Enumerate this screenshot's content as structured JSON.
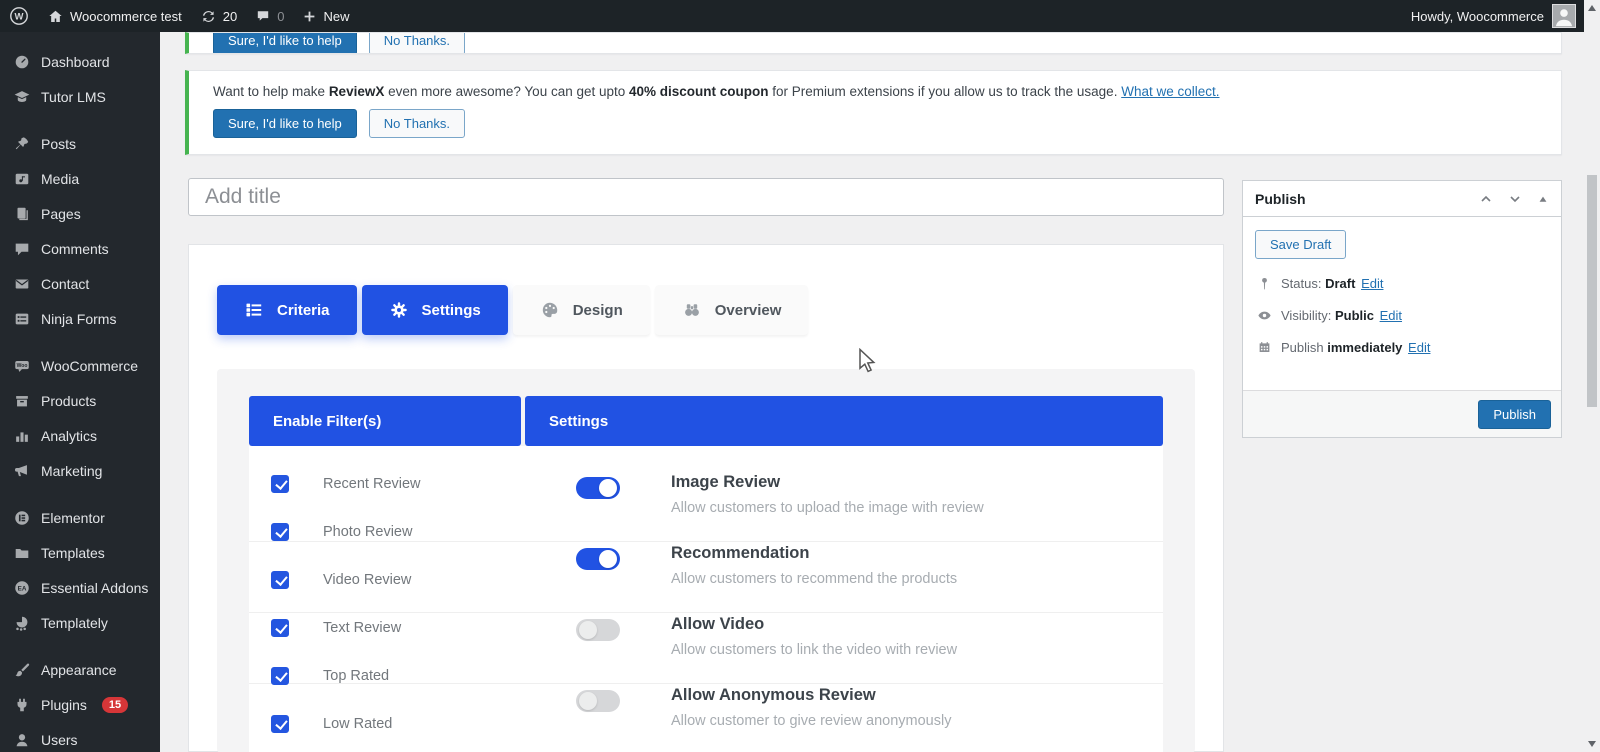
{
  "admin_bar": {
    "site_name": "Woocommerce test",
    "update_count": "20",
    "comment_count": "0",
    "new_label": "New",
    "howdy": "Howdy, Woocommerce"
  },
  "sidebar": {
    "items": [
      {
        "label": "Dashboard"
      },
      {
        "label": "Tutor LMS"
      },
      {
        "label": "Posts"
      },
      {
        "label": "Media"
      },
      {
        "label": "Pages"
      },
      {
        "label": "Comments"
      },
      {
        "label": "Contact"
      },
      {
        "label": "Ninja Forms"
      },
      {
        "label": "WooCommerce"
      },
      {
        "label": "Products"
      },
      {
        "label": "Analytics"
      },
      {
        "label": "Marketing"
      },
      {
        "label": "Elementor"
      },
      {
        "label": "Templates"
      },
      {
        "label": "Essential Addons"
      },
      {
        "label": "Templately"
      },
      {
        "label": "Appearance"
      },
      {
        "label": "Plugins",
        "badge": "15"
      },
      {
        "label": "Users"
      }
    ]
  },
  "notice": {
    "message_prefix": "Want to help make ",
    "brand": "ReviewX",
    "message_mid": " even more awesome? You can get upto ",
    "highlight": "40% discount coupon",
    "message_suffix": " for Premium extensions if you allow us to track the usage. ",
    "link": "What we collect.",
    "accept_label": "Sure, I'd like to help",
    "decline_label": "No Thanks."
  },
  "editor": {
    "title_placeholder": "Add title"
  },
  "tabs": [
    {
      "label": "Criteria",
      "active": true
    },
    {
      "label": "Settings",
      "active": true
    },
    {
      "label": "Design",
      "active": false
    },
    {
      "label": "Overview",
      "active": false
    }
  ],
  "filter_table": {
    "headers": [
      "Enable Filter(s)",
      "Settings"
    ],
    "filters": [
      {
        "label": "Recent Review",
        "checked": true
      },
      {
        "label": "Photo Review",
        "checked": true
      },
      {
        "label": "Video Review",
        "checked": true
      },
      {
        "label": "Text Review",
        "checked": true
      },
      {
        "label": "Top Rated",
        "checked": true
      },
      {
        "label": "Low Rated",
        "checked": true
      }
    ],
    "settings": [
      {
        "title": "Image Review",
        "description": "Allow customers to upload the image with review",
        "enabled": true
      },
      {
        "title": "Recommendation",
        "description": "Allow customers to recommend the products",
        "enabled": true
      },
      {
        "title": "Allow Video",
        "description": "Allow customers to link the video with review",
        "enabled": false
      },
      {
        "title": "Allow Anonymous Review",
        "description": "Allow customer to give review anonymously",
        "enabled": false
      }
    ]
  },
  "publish_panel": {
    "title": "Publish",
    "save_draft_label": "Save Draft",
    "status_label": "Status:",
    "status_value": "Draft",
    "visibility_label": "Visibility:",
    "visibility_value": "Public",
    "schedule_label": "Publish",
    "schedule_value": "immediately",
    "edit_label": "Edit",
    "publish_label": "Publish"
  },
  "colors": {
    "accent_blue": "#2152e3",
    "wp_button_blue": "#2271b1",
    "notice_green": "#46b450",
    "badge_red": "#d63638",
    "admin_bar_bg": "#1d2327",
    "sidebar_bg": "#23282d"
  }
}
